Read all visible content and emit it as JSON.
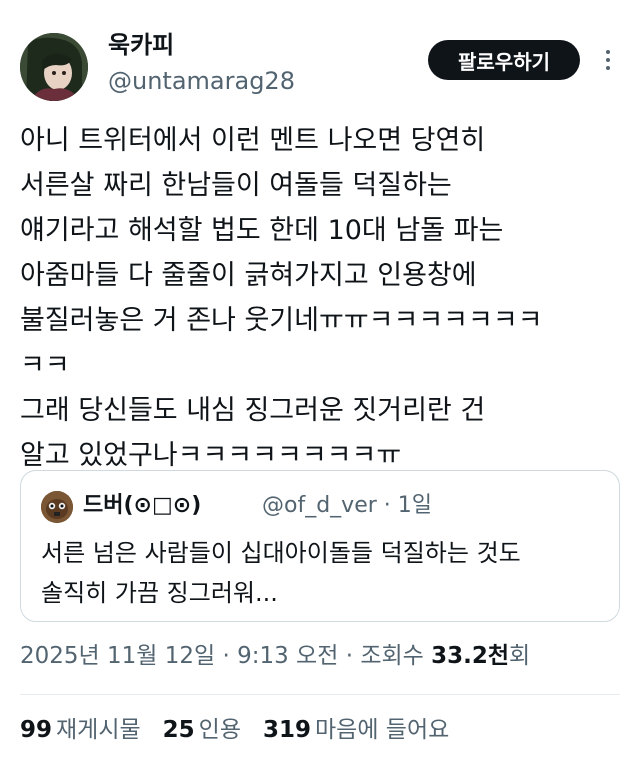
{
  "author": {
    "display_name": "욱카피",
    "handle": "@untamarag28"
  },
  "follow_label": "팔로우하기",
  "body_lines": [
    "아니 트위터에서 이런 멘트 나오면 당연히",
    "서른살 짜리 한남들이 여돌들 덕질하는",
    "얘기라고 해석할 법도 한데 10대 남돌 파는",
    "아줌마들 다 줄줄이 긁혀가지고 인용창에",
    "불질러놓은 거 존나 웃기네ㅠㅠㅋㅋㅋㅋㅋㅋㅋ",
    "ㅋㅋ",
    "그래 당신들도 내심 징그러운 짓거리란 건",
    "알고 있었구나ㅋㅋㅋㅋㅋㅋㅋㅋㅠ"
  ],
  "quote": {
    "display_name": "드버(⊙□⊙)",
    "handle_time": "@of_d_ver · 1일",
    "lines": [
      "서른 넘은 사람들이 십대아이돌들 덕질하는 것도",
      "솔직히 가끔 징그러워..."
    ]
  },
  "meta": {
    "timestamp": "2025년 11월 12일 · 9:13 오전 · 조회수 ",
    "views_count": "33.2천",
    "views_suffix": "회"
  },
  "stats": {
    "reposts_count": "99",
    "reposts_label": "재게시물",
    "quotes_count": "25",
    "quotes_label": "인용",
    "likes_count": "319",
    "likes_label": "마음에 들어요"
  },
  "colors": {
    "text": "#0f1419",
    "secondary": "#536471",
    "border": "#cfd9de",
    "button_bg": "#0f1419"
  }
}
